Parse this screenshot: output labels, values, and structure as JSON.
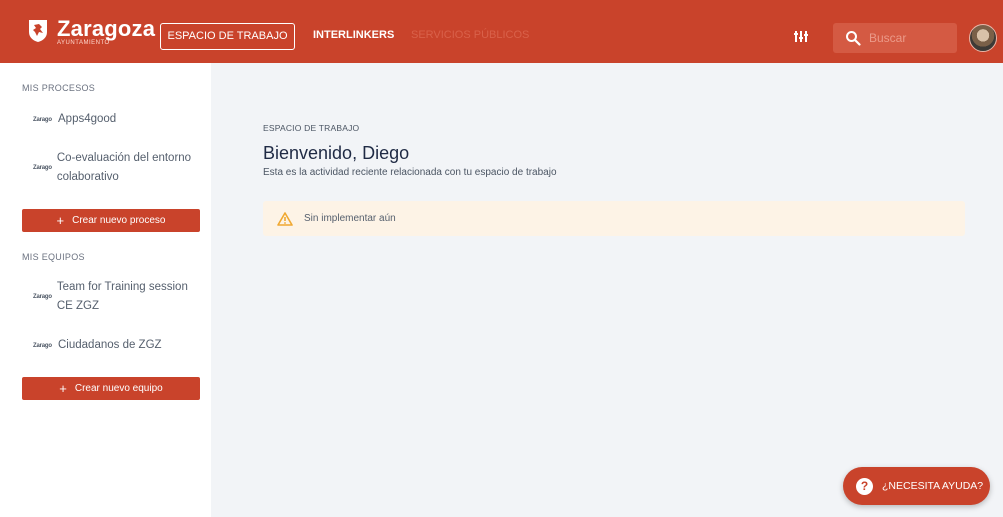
{
  "header": {
    "brand": "Zaragoza",
    "brand_sub": "AYUNTAMIENTO",
    "tabs": [
      {
        "label": "ESPACIO DE TRABAJO",
        "active": true
      },
      {
        "label": "INTERLINKERS",
        "active": false
      },
      {
        "label": "SERVICIOS PÚBLICOS",
        "active": false
      }
    ],
    "search_placeholder": "Buscar",
    "accent_color": "#c9432b"
  },
  "sidebar": {
    "processes_title": "MIS PROCESOS",
    "processes": [
      {
        "logo": "Zarago",
        "label": "Apps4good"
      },
      {
        "logo": "Zarago",
        "label": "Co-evaluación del entorno colaborativo"
      }
    ],
    "new_process_label": "Crear nuevo proceso",
    "teams_title": "MIS EQUIPOS",
    "teams": [
      {
        "logo": "Zarago",
        "label": "Team for Training session CE ZGZ"
      },
      {
        "logo": "Zarago",
        "label": "Ciudadanos de ZGZ"
      }
    ],
    "new_team_label": "Crear nuevo equipo"
  },
  "main": {
    "section_label": "ESPACIO DE TRABAJO",
    "title": "Bienvenido, Diego",
    "subtitle": "Esta es la actividad reciente relacionada con tu espacio de trabajo",
    "alert": "Sin implementar aún"
  },
  "help": {
    "label": "¿NECESITA AYUDA?",
    "icon_glyph": "?"
  }
}
